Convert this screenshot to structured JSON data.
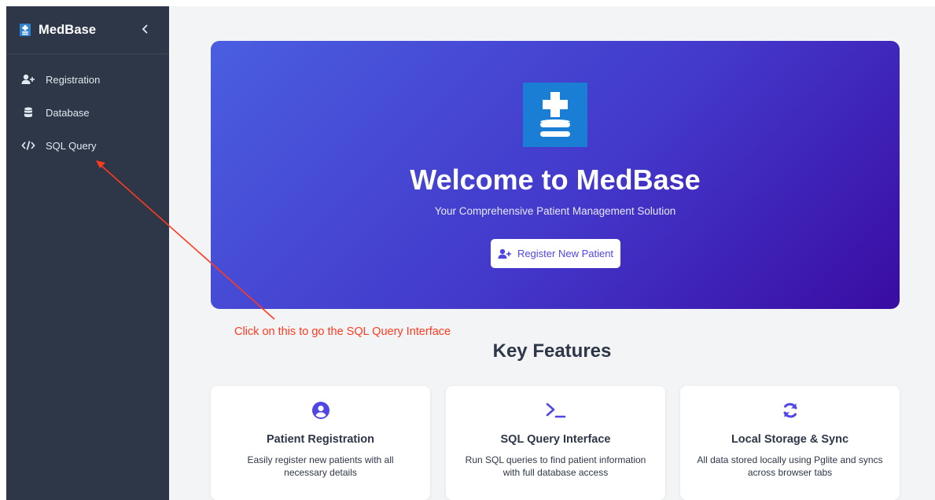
{
  "sidebar": {
    "brand": "MedBase",
    "collapse_icon": "chevron-left-icon",
    "items": [
      {
        "label": "Registration",
        "icon": "user-plus-icon"
      },
      {
        "label": "Database",
        "icon": "database-icon"
      },
      {
        "label": "SQL Query",
        "icon": "code-icon"
      }
    ]
  },
  "hero": {
    "title": "Welcome to MedBase",
    "subtitle": "Your Comprehensive Patient Management Solution",
    "button_label": "Register New Patient",
    "button_icon": "user-plus-icon"
  },
  "annotation": {
    "text": "Click on this to go the SQL Query Interface",
    "color": "#ff3b1f"
  },
  "features": {
    "title": "Key Features",
    "cards": [
      {
        "icon": "user-circle-icon",
        "title": "Patient Registration",
        "description": "Easily register new patients with all necessary details"
      },
      {
        "icon": "terminal-icon",
        "title": "SQL Query Interface",
        "description": "Run SQL queries to find patient information with full database access"
      },
      {
        "icon": "sync-icon",
        "title": "Local Storage & Sync",
        "description": "All data stored locally using Pglite and syncs across browser tabs"
      }
    ]
  },
  "colors": {
    "sidebar_bg": "#2d3748",
    "accent": "#4f46e5",
    "hero_start": "#4a5ee0",
    "hero_end": "#3a0ca3",
    "logo_blue": "#1a7fd4"
  }
}
